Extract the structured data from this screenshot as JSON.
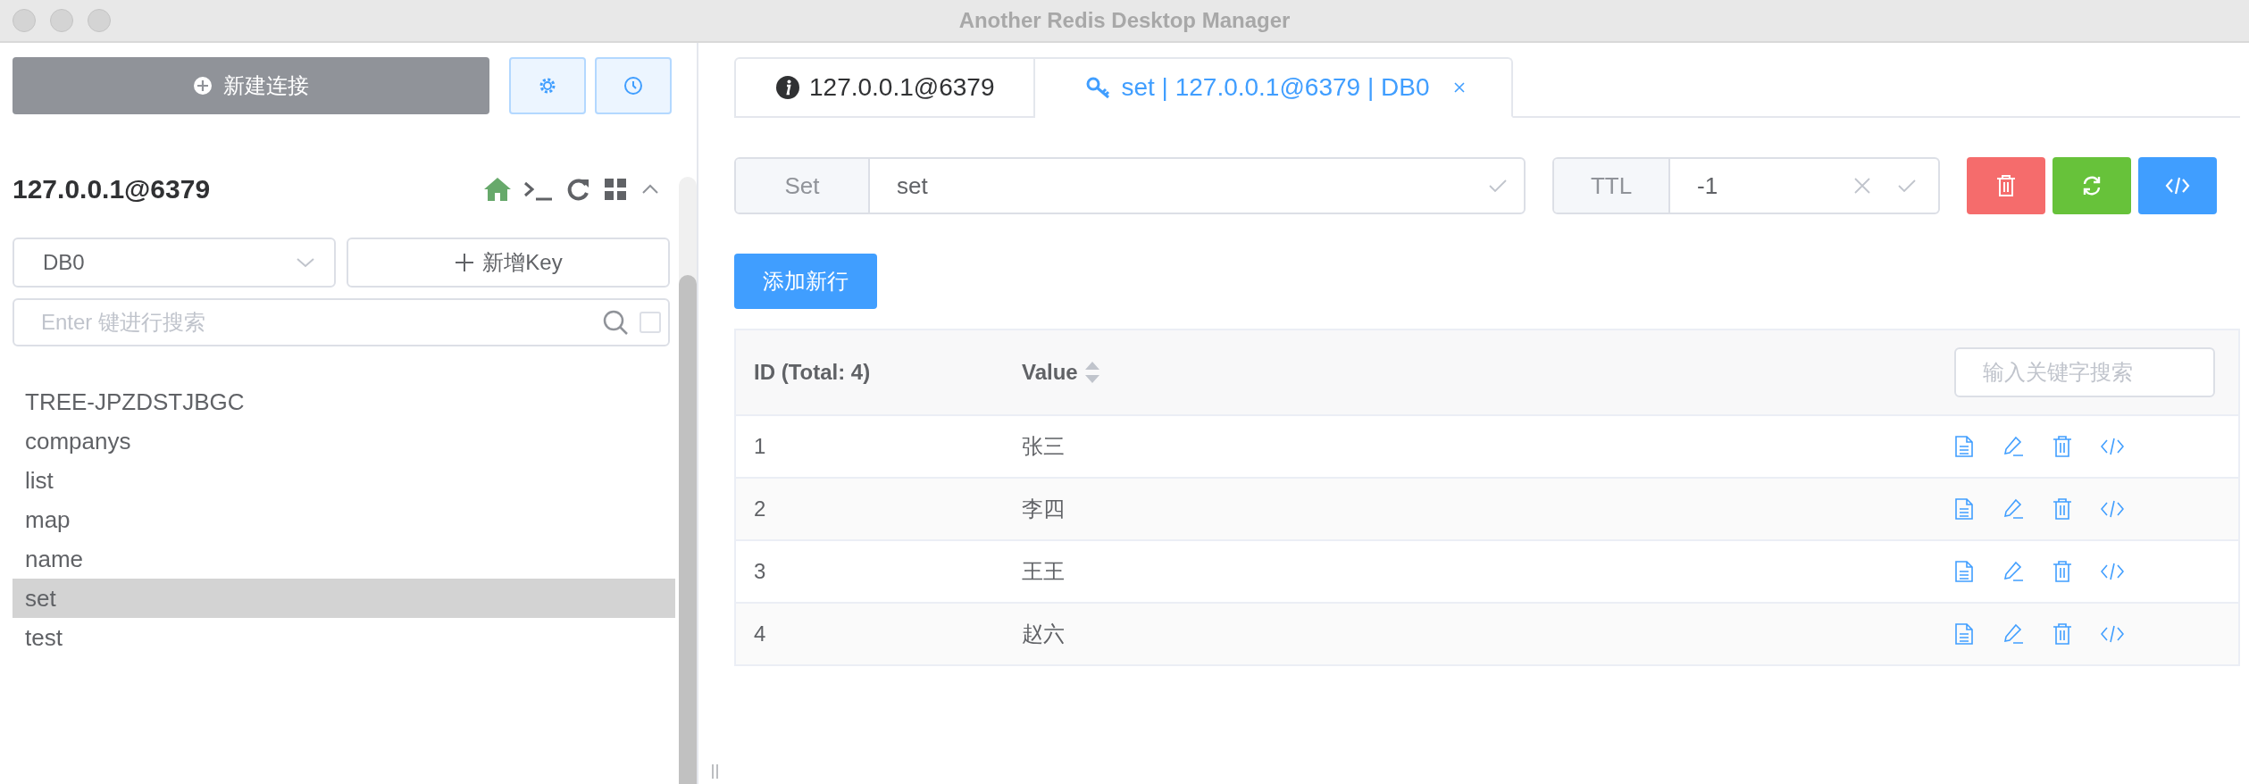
{
  "window": {
    "title": "Another Redis Desktop Manager"
  },
  "sidebar": {
    "new_connection": "新建连接",
    "connection": {
      "name": "127.0.0.1@6379",
      "expanded": true
    },
    "db_select": {
      "value": "DB0"
    },
    "new_key": "新增Key",
    "search": {
      "placeholder": "Enter 键进行搜索",
      "exact": false
    },
    "keys": [
      {
        "name": "TREE-JPZDSTJBGC",
        "selected": false
      },
      {
        "name": "companys",
        "selected": false
      },
      {
        "name": "list",
        "selected": false
      },
      {
        "name": "map",
        "selected": false
      },
      {
        "name": "name",
        "selected": false
      },
      {
        "name": "set",
        "selected": true
      },
      {
        "name": "test",
        "selected": false
      }
    ]
  },
  "tabs": [
    {
      "kind": "info",
      "label": "127.0.0.1@6379",
      "selected": false,
      "closable": false
    },
    {
      "kind": "key",
      "label": "set | 127.0.0.1@6379 | DB0",
      "selected": true,
      "closable": true
    }
  ],
  "key_bar": {
    "type_label": "Set",
    "key_value": "set",
    "ttl_label": "TTL",
    "ttl_value": "-1"
  },
  "add_row": "添加新行",
  "table": {
    "columns": [
      "ID (Total: 4)",
      "Value"
    ],
    "search_placeholder": "输入关键字搜索",
    "rows": [
      {
        "id": "1",
        "value": "张三"
      },
      {
        "id": "2",
        "value": "李四"
      },
      {
        "id": "3",
        "value": "王王"
      },
      {
        "id": "4",
        "value": "赵六"
      }
    ]
  }
}
